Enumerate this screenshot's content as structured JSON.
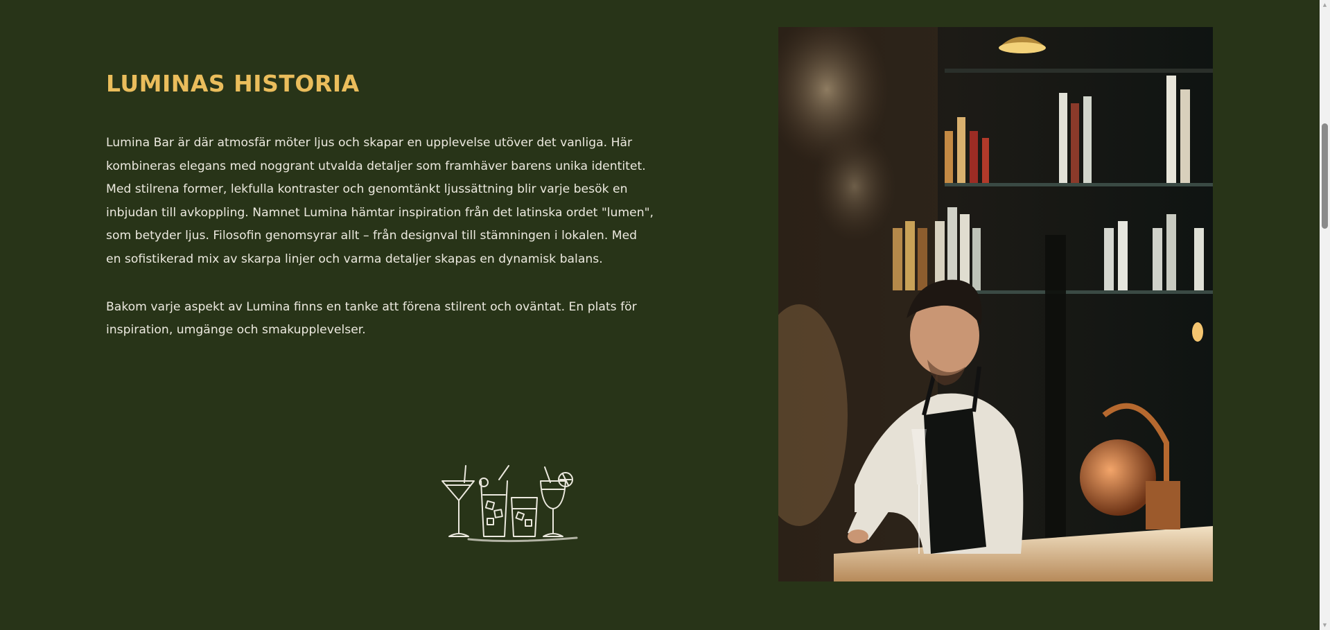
{
  "section": {
    "heading": "LUMINAS HISTORIA",
    "paragraphs": [
      "Lumina Bar är där atmosfär möter ljus och skapar en upplevelse utöver det vanliga. Här kombineras elegans med noggrant utvalda detaljer som framhäver barens unika identitet. Med stilrena former, lekfulla kontraster och genomtänkt ljussättning blir varje besök en inbjudan till avkoppling. Namnet Lumina hämtar inspiration från det latinska ordet \"lumen\", som betyder ljus. Filosofin genomsyrar allt – från designval till stämningen i lokalen. Med en sofistikerad mix av skarpa linjer och varma detaljer skapas en dynamisk balans.",
      "Bakom varje aspekt av Lumina finns en tanke att förena stilrent och oväntat. En plats för inspiration, umgänge och smakupplevelser."
    ],
    "illustration_icon": "cocktail-glasses-icon",
    "photo_subject": "bartender-photo"
  },
  "colors": {
    "background": "#283418",
    "heading": "#eabd5c",
    "text": "#ece9df"
  },
  "scrollbar": {
    "up_arrow": "▲",
    "down_arrow": "▼"
  }
}
